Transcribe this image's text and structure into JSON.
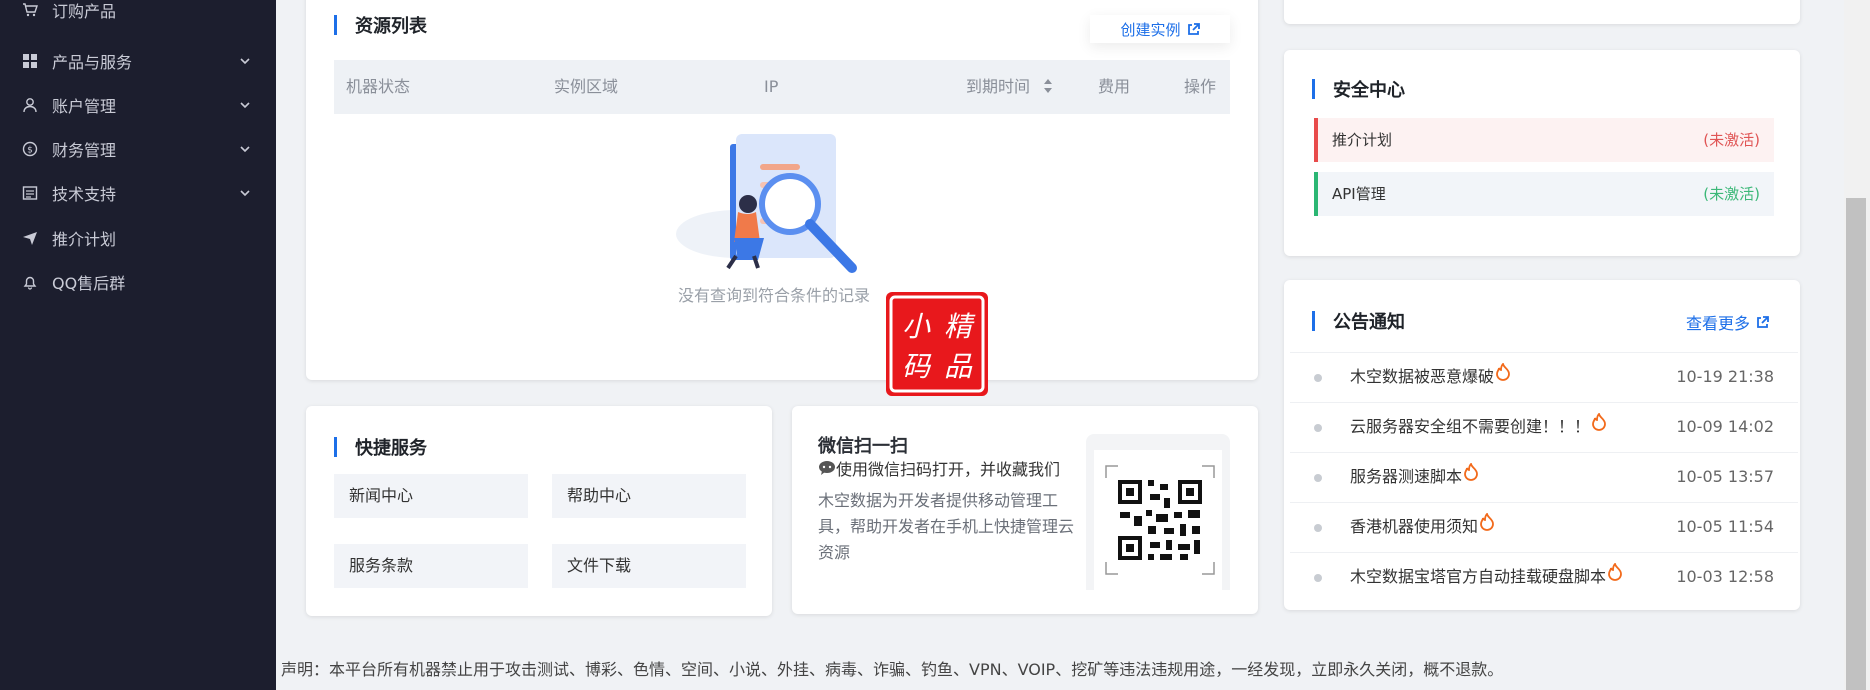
{
  "sidebar": {
    "items": [
      {
        "label": "订购产品",
        "icon": "cart-icon"
      },
      {
        "label": "产品与服务",
        "icon": "grid-icon"
      },
      {
        "label": "账户管理",
        "icon": "user-icon"
      },
      {
        "label": "财务管理",
        "icon": "dollar-icon"
      },
      {
        "label": "技术支持",
        "icon": "document-icon"
      },
      {
        "label": "推介计划",
        "icon": "send-icon"
      },
      {
        "label": "QQ售后群",
        "icon": "bell-icon"
      }
    ]
  },
  "resources": {
    "title": "资源列表",
    "create_label": "创建实例",
    "columns": [
      "机器状态",
      "实例区域",
      "IP",
      "到期时间",
      "费用",
      "操作"
    ],
    "empty_text": "没有查询到符合条件的记录"
  },
  "quick": {
    "title": "快捷服务",
    "buttons": [
      "新闻中心",
      "帮助中心",
      "服务条款",
      "文件下载"
    ]
  },
  "wechat": {
    "title": "微信扫一扫",
    "subtitle": "使用微信扫码打开，并收藏我们",
    "description": "木空数据为开发者提供移动管理工具，帮助开发者在手机上快捷管理云资源"
  },
  "security": {
    "title": "安全中心",
    "items": [
      {
        "name": "推介计划",
        "status": "(未激活)",
        "accent": "#e84b4b",
        "bg": "#fdf2f2",
        "status_color": "#e05555"
      },
      {
        "name": "API管理",
        "status": "(未激活)",
        "accent": "#2bb673",
        "bg": "#f2f5f9",
        "status_color": "#3cb878"
      }
    ]
  },
  "announcements": {
    "title": "公告通知",
    "more_label": "查看更多",
    "items": [
      {
        "title": "木空数据被恶意爆破",
        "date": "10-19 21:38"
      },
      {
        "title": "云服务器安全组不需要创建！！！",
        "date": "10-09 14:02"
      },
      {
        "title": "服务器测速脚本",
        "date": "10-05 13:57"
      },
      {
        "title": "香港机器使用须知",
        "date": "10-05 11:54"
      },
      {
        "title": "木空数据宝塔官方自动挂载硬盘脚本",
        "date": "10-03 12:58"
      }
    ]
  },
  "footer": {
    "text": "声明：本平台所有机器禁止用于攻击测试、博彩、色情、空间、小说、外挂、病毒、诈骗、钓鱼、VPN、VOIP、挖矿等违法违规用途，一经发现，立即永久关闭，概不退款。"
  },
  "seal": {
    "text": "小精码品"
  },
  "colors": {
    "accent": "#1d6fe8",
    "sidebar_bg": "#1c1e2e",
    "fire": "#f26a1b"
  }
}
